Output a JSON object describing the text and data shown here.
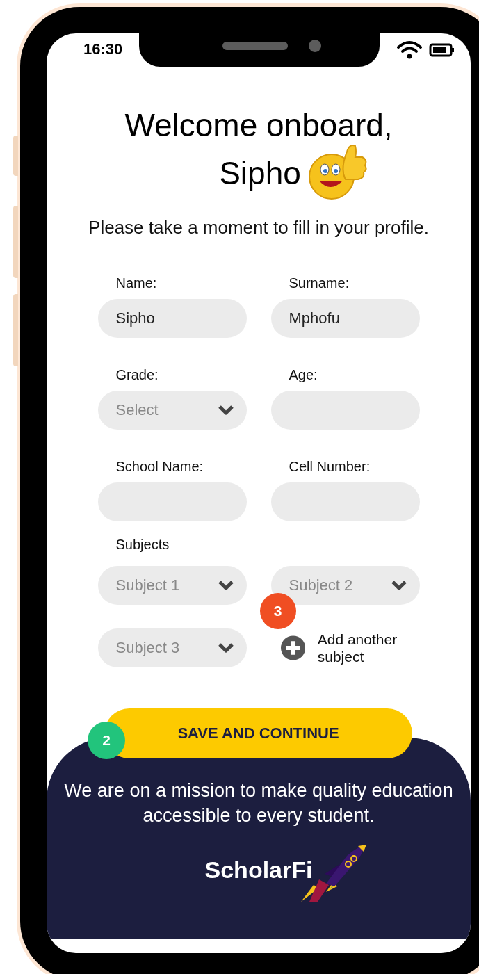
{
  "status_bar": {
    "time": "16:30"
  },
  "heading": {
    "line_1": "Welcome onboard,",
    "line_2": "Sipho"
  },
  "subtitle": "Please take a moment to fill in your profile.",
  "fields": [
    {
      "kind": "text",
      "label": "Name:",
      "value": "Sipho"
    },
    {
      "kind": "text",
      "label": "Surname:",
      "value": "Mphofu"
    },
    {
      "kind": "select",
      "label": "Grade:",
      "placeholder": "Select"
    },
    {
      "kind": "text",
      "label": "Age:"
    },
    {
      "kind": "text",
      "label": "School Name:"
    },
    {
      "kind": "text",
      "label": "Cell Number:"
    }
  ],
  "subjects": {
    "label": "Subjects",
    "selects": [
      {
        "placeholder": "Subject 1"
      },
      {
        "placeholder": "Subject 2"
      },
      {
        "placeholder": "Subject 3"
      }
    ],
    "add_button": "Add another subject"
  },
  "markers": [
    {
      "text": "3",
      "color": "#f04e23"
    },
    {
      "text": "2",
      "color": "#22c47c"
    }
  ],
  "save_button": "SAVE AND CONTINUE",
  "footer": {
    "mission": "We are on a mission to make quality education accessible to every student.",
    "logo": "ScholarFi"
  }
}
